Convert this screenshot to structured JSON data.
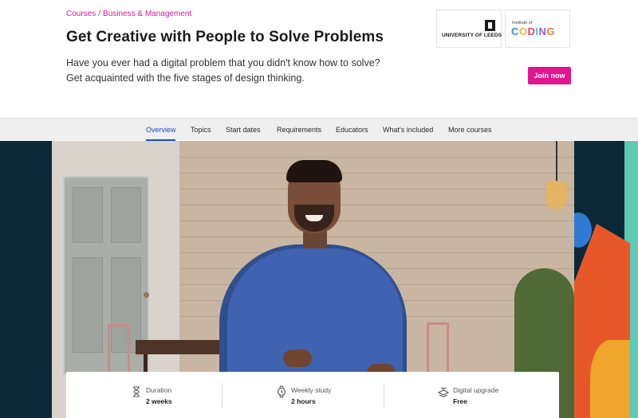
{
  "breadcrumb": {
    "courses": "Courses",
    "separator": "/",
    "category": "Business & Management"
  },
  "page": {
    "title": "Get Creative with People to Solve Problems",
    "description_line1": "Have you ever had a digital problem that you didn't know how to solve?",
    "description_line2": "Get acquainted with the five stages of design thinking."
  },
  "partners": {
    "leeds": "UNIVERSITY OF LEEDS",
    "ioc_small": "Institute of",
    "ioc_letters": [
      "C",
      "O",
      "D",
      "I",
      "N",
      "G"
    ]
  },
  "cta": {
    "join_label": "Join now",
    "color": "#e3148f"
  },
  "nav": {
    "items": [
      {
        "label": "Overview",
        "active": true
      },
      {
        "label": "Topics"
      },
      {
        "label": "Start dates"
      },
      {
        "label": "Requirements"
      },
      {
        "label": "Educators"
      },
      {
        "label": "What's included"
      },
      {
        "label": "More courses"
      }
    ],
    "active_color": "#1a4fbd"
  },
  "info": {
    "duration": {
      "icon": "hourglass-icon",
      "label": "Duration",
      "value": "2 weeks"
    },
    "weekly": {
      "icon": "watch-icon",
      "label": "Weekly study",
      "value": "2 hours"
    },
    "upgrade": {
      "icon": "certificate-icon",
      "label": "Digital upgrade",
      "value": "Free"
    }
  }
}
